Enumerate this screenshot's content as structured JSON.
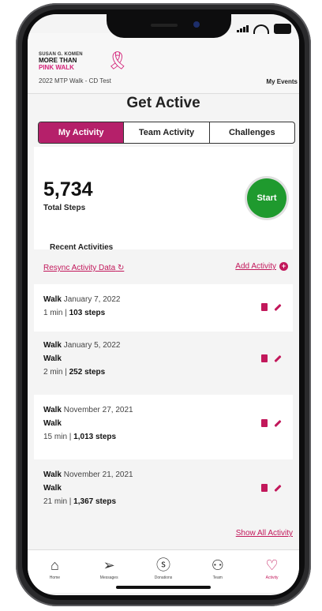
{
  "header": {
    "logo_top": "SUSAN G. KOMEN",
    "logo_line1": "MORE THAN",
    "logo_line2": "PINK WALK",
    "event_name": "2022 MTP Walk - CD Test",
    "my_events": "My Events"
  },
  "page": {
    "title": "Get Active"
  },
  "tabs": [
    {
      "label": "My Activity",
      "active": true
    },
    {
      "label": "Team Activity",
      "active": false
    },
    {
      "label": "Challenges",
      "active": false
    }
  ],
  "summary": {
    "steps": "5,734",
    "steps_label": "Total Steps",
    "start_label": "Start",
    "recent_heading": "Recent Activities"
  },
  "links": {
    "resync": "Resync Activity Data",
    "add_activity": "Add Activity"
  },
  "activities": [
    {
      "type": "Walk",
      "date": "January 7, 2022",
      "subtype": "",
      "duration": "1 min",
      "steps": "103 steps"
    },
    {
      "type": "Walk",
      "date": "January 5, 2022",
      "subtype": "Walk",
      "duration": "2 min",
      "steps": "252 steps"
    },
    {
      "type": "Walk",
      "date": "November 27, 2021",
      "subtype": "Walk",
      "duration": "15 min",
      "steps": "1,013 steps"
    },
    {
      "type": "Walk",
      "date": "November 21, 2021",
      "subtype": "Walk",
      "duration": "21 min",
      "steps": "1,367 steps"
    }
  ],
  "show_all": "Show All Activity",
  "bottom_nav": [
    {
      "label": "Home",
      "icon": "home-icon",
      "active": false
    },
    {
      "label": "Messages",
      "icon": "send-icon",
      "active": false
    },
    {
      "label": "Donations",
      "icon": "dollar-icon",
      "active": false
    },
    {
      "label": "Team",
      "icon": "people-icon",
      "active": false
    },
    {
      "label": "Activity",
      "icon": "heart-pulse-icon",
      "active": true
    }
  ],
  "colors": {
    "brand_pink": "#c2185b",
    "tab_active": "#b5206a",
    "start_green": "#1f9a2e"
  }
}
